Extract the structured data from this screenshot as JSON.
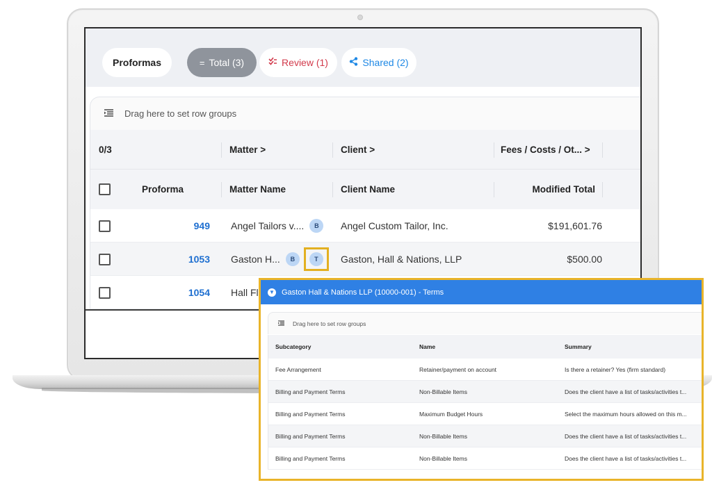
{
  "tabs": {
    "proformas": "Proformas",
    "total": "Total (3)",
    "review": "Review (1)",
    "shared": "Shared (2)"
  },
  "groupbar": {
    "label": "Drag here to set row groups",
    "icon": "row-group-icon"
  },
  "grid": {
    "selection_count": "0/3",
    "group_headers": [
      "Matter >",
      "Client >",
      "Fees / Costs / Ot... >"
    ],
    "columns": [
      "Proforma",
      "Matter Name",
      "Client Name",
      "Modified Total"
    ],
    "rows": [
      {
        "proforma": "949",
        "matter": "Angel Tailors v....",
        "badges": [
          "B"
        ],
        "client": "Angel Custom Tailor, Inc.",
        "total": "$191,601.76"
      },
      {
        "proforma": "1053",
        "matter": "Gaston H...",
        "badges": [
          "B",
          "T"
        ],
        "client": "Gaston, Hall & Nations, LLP",
        "total": "$500.00"
      },
      {
        "proforma": "1054",
        "matter": "Hall Fl",
        "badges": [],
        "client": "",
        "total": ""
      }
    ]
  },
  "popup": {
    "title": "Gaston Hall & Nations LLP (10000-001) - Terms",
    "title_icon": "filter-icon",
    "group_label": "Drag here to set row groups",
    "columns": [
      "Subcategory",
      "Name",
      "Summary"
    ],
    "rows": [
      {
        "subcategory": "Fee Arrangement",
        "name": "Retainer/payment on account",
        "summary": "Is there a retainer? Yes (firm standard)"
      },
      {
        "subcategory": "Billing and Payment Terms",
        "name": "Non-Billable Items",
        "summary": "Does the client have a list of tasks/activities t..."
      },
      {
        "subcategory": "Billing and Payment Terms",
        "name": "Maximum Budget Hours",
        "summary": "Select the maximum hours allowed on this m..."
      },
      {
        "subcategory": "Billing and Payment Terms",
        "name": "Non-Billable Items",
        "summary": "Does the client have a list of tasks/activities t..."
      },
      {
        "subcategory": "Billing and Payment Terms",
        "name": "Non-Billable Items",
        "summary": "Does the client have a list of tasks/activities t..."
      }
    ]
  },
  "colors": {
    "accent": "#2f80e4",
    "highlight": "#e9b42a",
    "review": "#d23a4b",
    "link": "#1e6fd0"
  }
}
